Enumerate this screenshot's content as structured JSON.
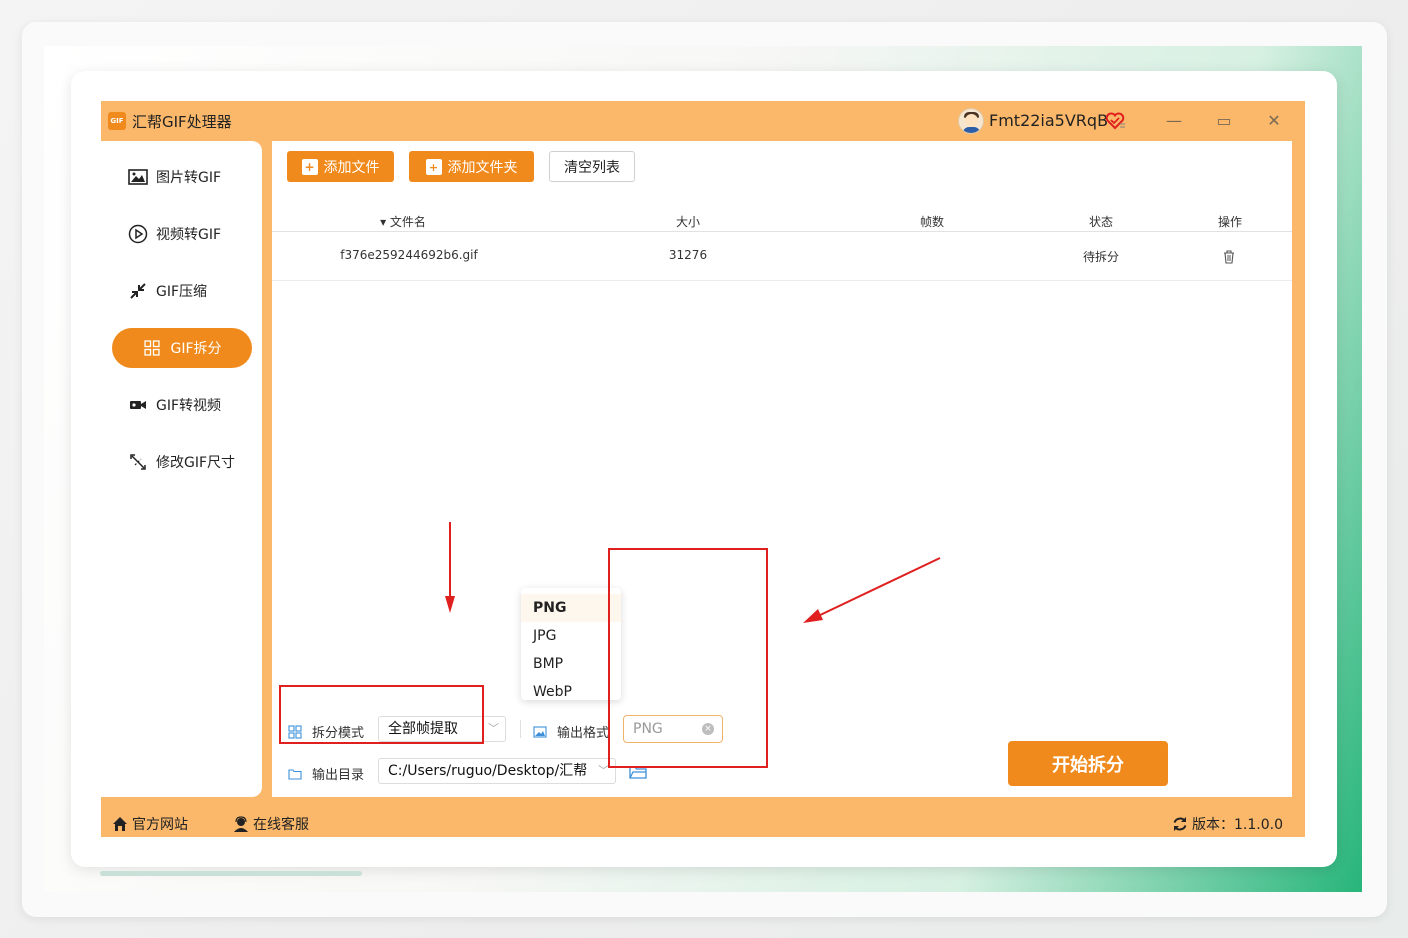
{
  "app": {
    "title": "汇帮GIF处理器",
    "logo_text": "GIF",
    "username": "Fmt22ia5VRqB",
    "window_controls": {
      "minimize": "—",
      "maximize": "▭",
      "close": "✕"
    }
  },
  "sidebar": {
    "items": [
      {
        "label": "图片转GIF",
        "icon": "image-icon",
        "active": false
      },
      {
        "label": "视频转GIF",
        "icon": "play-circle-icon",
        "active": false
      },
      {
        "label": "GIF压缩",
        "icon": "compress-icon",
        "active": false
      },
      {
        "label": "GIF拆分",
        "icon": "split-grid-icon",
        "active": true
      },
      {
        "label": "GIF转视频",
        "icon": "video-camera-icon",
        "active": false
      },
      {
        "label": "修改GIF尺寸",
        "icon": "resize-icon",
        "active": false
      }
    ]
  },
  "toolbar": {
    "add_file": "添加文件",
    "add_folder": "添加文件夹",
    "clear_list": "清空列表"
  },
  "table": {
    "columns": [
      "▾ 文件名",
      "大小",
      "帧数",
      "状态",
      "操作"
    ],
    "rows": [
      {
        "filename": "f376e259244692b6.gif",
        "size": "31276",
        "frames": "",
        "status": "待拆分"
      }
    ]
  },
  "options": {
    "split_mode_label": "拆分模式",
    "split_mode_value": "全部帧提取",
    "output_format_label": "输出格式",
    "output_format_placeholder": "PNG",
    "output_dir_label": "输出目录",
    "output_dir_value": "C:/Users/ruguo/Desktop/汇帮"
  },
  "dropdown": {
    "options": [
      "PNG",
      "JPG",
      "BMP",
      "WebP"
    ],
    "selected": "PNG"
  },
  "start_button": "开始拆分",
  "footer": {
    "website": "官方网站",
    "support": "在线客服",
    "version": "版本：1.1.0.0"
  },
  "colors": {
    "accent": "#f08a1c",
    "frame": "#fbb86a",
    "annotation": "#e0201f"
  }
}
